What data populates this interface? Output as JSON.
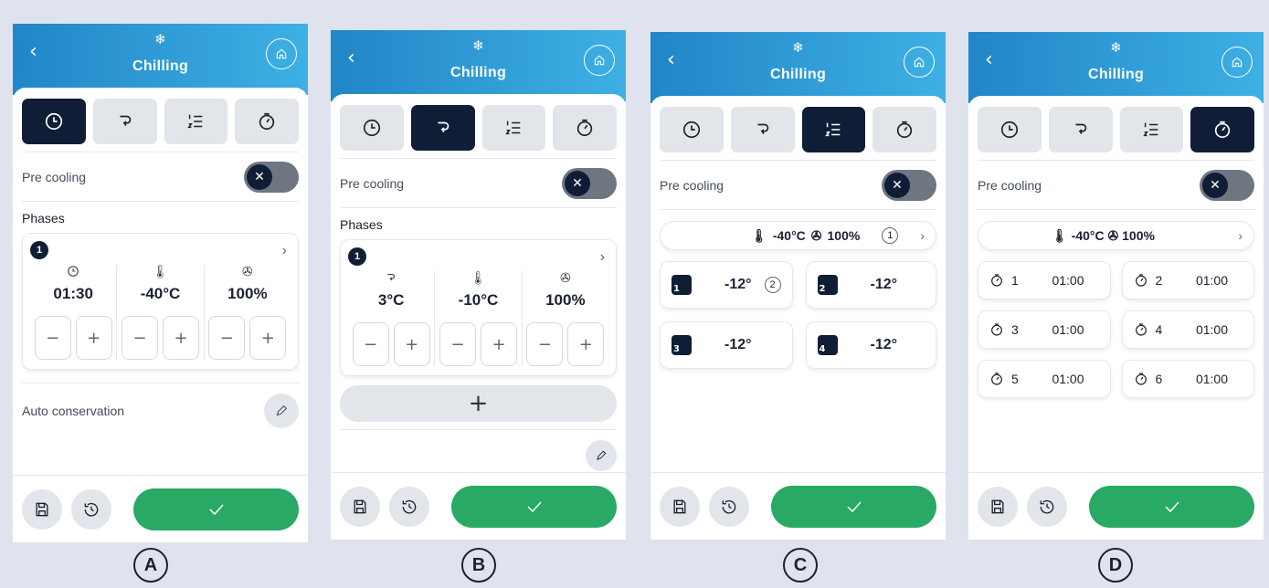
{
  "header_title": "Chilling",
  "back_glyph": "‹",
  "snow_glyph": "❄",
  "pre_cooling": "Pre cooling",
  "phases_label": "Phases",
  "auto_conservation": "Auto conservation",
  "phase_number": "1",
  "panel_letters": [
    "A",
    "B",
    "C",
    "D"
  ],
  "panel_a": {
    "time": "01:30",
    "temp": "-40°C",
    "fan": "100%"
  },
  "panel_b": {
    "probe": "3°C",
    "temp": "-10°C",
    "fan": "100%",
    "add": "+"
  },
  "panel_c": {
    "temp": "-40°C",
    "fan": "100%",
    "circle1": "1",
    "circle2": "2",
    "cards": [
      {
        "n": "1",
        "v": "-12°"
      },
      {
        "n": "2",
        "v": "-12°"
      },
      {
        "n": "3",
        "v": "-12°"
      },
      {
        "n": "4",
        "v": "-12°"
      }
    ]
  },
  "panel_d": {
    "temp": "-40°C",
    "fan": "100%",
    "timers": [
      {
        "n": "1",
        "v": "01:00"
      },
      {
        "n": "2",
        "v": "01:00"
      },
      {
        "n": "3",
        "v": "01:00"
      },
      {
        "n": "4",
        "v": "01:00"
      },
      {
        "n": "5",
        "v": "01:00"
      },
      {
        "n": "6",
        "v": "01:00"
      }
    ]
  },
  "colors": {
    "header": "#2186c7",
    "active_tab": "#0f1e36",
    "confirm": "#28a964"
  },
  "icons": [
    "home-icon",
    "clock-icon",
    "probe-icon",
    "list-icon",
    "timer-icon",
    "thermometer-icon",
    "fan-icon",
    "save-icon",
    "history-icon",
    "check-icon",
    "pencil-icon"
  ]
}
